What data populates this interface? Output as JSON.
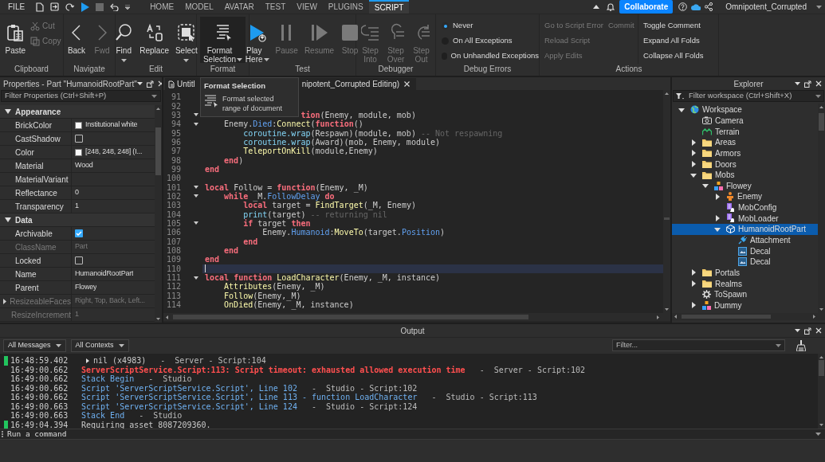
{
  "menu": {
    "file": "FILE",
    "tabs": [
      {
        "label": "HOME",
        "selected": false
      },
      {
        "label": "MODEL",
        "selected": false
      },
      {
        "label": "AVATAR",
        "selected": false
      },
      {
        "label": "TEST",
        "selected": false
      },
      {
        "label": "VIEW",
        "selected": false
      },
      {
        "label": "PLUGINS",
        "selected": false
      },
      {
        "label": "SCRIPT",
        "selected": true
      }
    ],
    "collaborate": "Collaborate",
    "user": "Omnipotent_Corrupted"
  },
  "ribbon": {
    "groups": [
      {
        "label": "Clipboard",
        "kind": "buttons",
        "items": [
          {
            "kind": "large",
            "label": "Paste",
            "disabled": false,
            "dropdown": false,
            "active": false
          },
          {
            "kind": "small",
            "label": "Cut",
            "disabled": true
          },
          {
            "kind": "small",
            "label": "Copy",
            "disabled": true
          }
        ]
      },
      {
        "label": "Navigate",
        "kind": "buttons",
        "items": [
          {
            "kind": "large",
            "label": "Back",
            "disabled": false,
            "dropdown": false,
            "active": false
          },
          {
            "kind": "large",
            "label": "Fwd",
            "disabled": true,
            "dropdown": false,
            "active": false
          }
        ]
      },
      {
        "label": "Edit",
        "kind": "buttons",
        "items": [
          {
            "kind": "large",
            "label": "Find",
            "disabled": false,
            "dropdown": true,
            "active": false
          },
          {
            "kind": "large",
            "label": "Replace",
            "disabled": false,
            "dropdown": false,
            "active": false
          },
          {
            "kind": "large",
            "label": "Select",
            "disabled": false,
            "dropdown": true,
            "active": false
          }
        ]
      },
      {
        "label": "Format",
        "kind": "buttons",
        "items": [
          {
            "kind": "large",
            "label": "Format Selection",
            "disabled": false,
            "dropdown": true,
            "active": true
          }
        ]
      },
      {
        "label": "Test",
        "kind": "buttons",
        "items": [
          {
            "kind": "large",
            "label": "Play Here",
            "disabled": false,
            "dropdown": true,
            "active": false
          },
          {
            "kind": "large",
            "label": "Pause",
            "disabled": true,
            "dropdown": false,
            "active": false
          },
          {
            "kind": "large",
            "label": "Resume",
            "disabled": true,
            "dropdown": false,
            "active": false
          },
          {
            "kind": "large",
            "label": "Stop",
            "disabled": true,
            "dropdown": false,
            "active": false
          }
        ]
      },
      {
        "label": "Debugger",
        "kind": "buttons",
        "items": [
          {
            "kind": "large",
            "label": "Step Into",
            "disabled": true,
            "dropdown": false,
            "active": false
          },
          {
            "kind": "large",
            "label": "Step Over",
            "disabled": true,
            "dropdown": false,
            "active": false
          },
          {
            "kind": "large",
            "label": "Step Out",
            "disabled": true,
            "dropdown": false,
            "active": false
          }
        ]
      },
      {
        "label": "Debug Errors",
        "kind": "radios",
        "items": [
          {
            "label": "Never",
            "selected": true
          },
          {
            "label": "On All Exceptions",
            "selected": false
          },
          {
            "label": "On Unhandled Exceptions",
            "selected": false
          }
        ]
      },
      {
        "label": "Actions",
        "kind": "columns",
        "columns": [
          [
            [
              {
                "label": "Go to Script Error",
                "disabled": true
              },
              {
                "label": "Commit",
                "disabled": true
              }
            ],
            [
              {
                "label": "Reload Script",
                "disabled": true
              }
            ],
            [
              {
                "label": "Apply Edits",
                "disabled": true
              }
            ]
          ],
          [
            [
              {
                "label": "Toggle Comment",
                "disabled": false
              }
            ],
            [
              {
                "label": "Expand All Folds",
                "disabled": false
              }
            ],
            [
              {
                "label": "Collapse All Folds",
                "disabled": false
              }
            ]
          ]
        ]
      }
    ]
  },
  "properties": {
    "title": "Properties - Part \"HumanoidRootPart\"",
    "filter_placeholder": "Filter Properties (Ctrl+Shift+P)",
    "sections": [
      {
        "name": "Appearance",
        "expanded": true,
        "rows": [
          {
            "name": "BrickColor",
            "kind": "swatch",
            "value": "Institutional white",
            "color": "#f8f8f8",
            "disabled": false
          },
          {
            "name": "CastShadow",
            "kind": "checkbox",
            "checked": false,
            "disabled": false
          },
          {
            "name": "Color",
            "kind": "swatch",
            "value": "[248, 248, 248] (I...",
            "color": "#f8f8f8",
            "disabled": false
          },
          {
            "name": "Material",
            "kind": "text",
            "value": "Wood",
            "disabled": false
          },
          {
            "name": "MaterialVariant",
            "kind": "text",
            "disabled": false
          },
          {
            "name": "Reflectance",
            "kind": "text",
            "value": "0",
            "disabled": false
          },
          {
            "name": "Transparency",
            "kind": "text",
            "value": "1",
            "disabled": false
          }
        ]
      },
      {
        "name": "Data",
        "expanded": true,
        "rows": [
          {
            "name": "Archivable",
            "kind": "checkbox",
            "checked": true,
            "disabled": false
          },
          {
            "name": "ClassName",
            "kind": "text",
            "value": "Part",
            "disabled": true
          },
          {
            "name": "Locked",
            "kind": "checkbox",
            "checked": false,
            "disabled": false
          },
          {
            "name": "Name",
            "kind": "text",
            "value": "HumanoidRootPart",
            "disabled": false
          },
          {
            "name": "Parent",
            "kind": "text",
            "value": "Flowey",
            "disabled": false
          },
          {
            "name": "ResizeableFaces",
            "kind": "group",
            "value": "Right, Top, Back, Left...",
            "disabled": true
          },
          {
            "name": "ResizeIncrement",
            "kind": "text",
            "value": "1",
            "disabled": true
          }
        ]
      }
    ]
  },
  "editor": {
    "tab_start": "Untitl",
    "tab_end": "nipotent_Corrupted Editing)",
    "tooltip": {
      "title": "Format Selection",
      "text": "Format selected range of document"
    },
    "lines": [
      {
        "n": "91",
        "fold": false,
        "current": false
      },
      {
        "n": "92",
        "fold": false,
        "current": false
      },
      {
        "n": "93",
        "fold": true,
        "current": false,
        "tokens": [
          {
            "kind": "k",
            "text": "                    tion"
          },
          {
            "kind": "p",
            "text": "(Enemy, module, mob)"
          }
        ]
      },
      {
        "n": "94",
        "fold": true,
        "current": false,
        "tokens": [
          {
            "kind": "p",
            "text": "    Enemy."
          },
          {
            "kind": "m",
            "text": "Died"
          },
          {
            "kind": "p",
            "text": ":"
          },
          {
            "kind": "f",
            "text": "Connect"
          },
          {
            "kind": "p",
            "text": "("
          },
          {
            "kind": "k",
            "text": "function"
          },
          {
            "kind": "p",
            "text": "()"
          }
        ]
      },
      {
        "n": "95",
        "fold": false,
        "current": false,
        "tokens": [
          {
            "kind": "b",
            "text": "        coroutine.wrap"
          },
          {
            "kind": "p",
            "text": "(Respawn)(module, mob)"
          },
          {
            "kind": "c",
            "text": " -- Not respawning"
          }
        ]
      },
      {
        "n": "96",
        "fold": false,
        "current": false,
        "tokens": [
          {
            "kind": "b",
            "text": "        coroutine.wrap"
          },
          {
            "kind": "p",
            "text": "(Award)(mob, Enemy, module)"
          }
        ]
      },
      {
        "n": "97",
        "fold": false,
        "current": false,
        "tokens": [
          {
            "kind": "f",
            "text": "        TeleportOnKill"
          },
          {
            "kind": "p",
            "text": "(module,Enemy)"
          }
        ]
      },
      {
        "n": "98",
        "fold": false,
        "current": false,
        "tokens": [
          {
            "kind": "k",
            "text": "    end"
          },
          {
            "kind": "p",
            "text": ")"
          }
        ]
      },
      {
        "n": "99",
        "fold": false,
        "current": false,
        "tokens": [
          {
            "kind": "k",
            "text": "end"
          }
        ]
      },
      {
        "n": "100",
        "fold": false,
        "current": false
      },
      {
        "n": "101",
        "fold": true,
        "current": false,
        "tokens": [
          {
            "kind": "k",
            "text": "local"
          },
          {
            "kind": "p",
            "text": " Follow = "
          },
          {
            "kind": "k",
            "text": "function"
          },
          {
            "kind": "p",
            "text": "(Enemy, _M)"
          }
        ]
      },
      {
        "n": "102",
        "fold": true,
        "current": false,
        "tokens": [
          {
            "kind": "k",
            "text": "    while"
          },
          {
            "kind": "p",
            "text": " _M."
          },
          {
            "kind": "m",
            "text": "FollowDelay"
          },
          {
            "kind": "k",
            "text": " do"
          }
        ]
      },
      {
        "n": "103",
        "fold": false,
        "current": false,
        "tokens": [
          {
            "kind": "k",
            "text": "        local"
          },
          {
            "kind": "p",
            "text": " target = "
          },
          {
            "kind": "f",
            "text": "FindTarget"
          },
          {
            "kind": "p",
            "text": "(_M, Enemy)"
          }
        ]
      },
      {
        "n": "104",
        "fold": false,
        "current": false,
        "tokens": [
          {
            "kind": "b",
            "text": "        print"
          },
          {
            "kind": "p",
            "text": "(target)"
          },
          {
            "kind": "c",
            "text": " -- returning nil"
          }
        ]
      },
      {
        "n": "105",
        "fold": true,
        "current": false,
        "tokens": [
          {
            "kind": "k",
            "text": "        if"
          },
          {
            "kind": "p",
            "text": " target "
          },
          {
            "kind": "k",
            "text": "then"
          }
        ]
      },
      {
        "n": "106",
        "fold": false,
        "current": false,
        "tokens": [
          {
            "kind": "p",
            "text": "            Enemy."
          },
          {
            "kind": "m",
            "text": "Humanoid"
          },
          {
            "kind": "p",
            "text": ":"
          },
          {
            "kind": "f",
            "text": "MoveTo"
          },
          {
            "kind": "p",
            "text": "(target."
          },
          {
            "kind": "m",
            "text": "Position"
          },
          {
            "kind": "p",
            "text": ")"
          }
        ]
      },
      {
        "n": "107",
        "fold": false,
        "current": false,
        "tokens": [
          {
            "kind": "k",
            "text": "        end"
          }
        ]
      },
      {
        "n": "108",
        "fold": false,
        "current": false,
        "tokens": [
          {
            "kind": "k",
            "text": "    end"
          }
        ]
      },
      {
        "n": "109",
        "fold": false,
        "current": false,
        "tokens": [
          {
            "kind": "k",
            "text": "end"
          }
        ]
      },
      {
        "n": "110",
        "fold": false,
        "current": true
      },
      {
        "n": "111",
        "fold": true,
        "current": false,
        "tokens": [
          {
            "kind": "k",
            "text": "local"
          },
          {
            "kind": "k",
            "text": " function"
          },
          {
            "kind": "f",
            "text": " LoadCharacter"
          },
          {
            "kind": "p",
            "text": "(Enemy, _M, instance)"
          }
        ]
      },
      {
        "n": "112",
        "fold": false,
        "current": false,
        "tokens": [
          {
            "kind": "f",
            "text": "    Attributes"
          },
          {
            "kind": "p",
            "text": "(Enemy, _M)"
          }
        ]
      },
      {
        "n": "113",
        "fold": false,
        "current": false,
        "tokens": [
          {
            "kind": "f",
            "text": "    Follow"
          },
          {
            "kind": "p",
            "text": "(Enemy,_M)"
          }
        ]
      },
      {
        "n": "114",
        "fold": false,
        "current": false,
        "tokens": [
          {
            "kind": "f",
            "text": "    OnDied"
          },
          {
            "kind": "p",
            "text": "(Enemy, _M, instance)"
          }
        ]
      }
    ]
  },
  "explorer": {
    "title": "Explorer",
    "filter_placeholder": "Filter workspace (Ctrl+Shift+X)",
    "tree": [
      {
        "name": "Workspace",
        "kind": "globe",
        "expandable": true,
        "expanded": true,
        "selected": false,
        "children": [
          {
            "name": "Camera",
            "kind": "camera",
            "expandable": false,
            "selected": false
          },
          {
            "name": "Terrain",
            "kind": "terrain",
            "expandable": false,
            "selected": false
          },
          {
            "name": "Areas",
            "kind": "folder",
            "expandable": true,
            "expanded": false,
            "selected": false
          },
          {
            "name": "Armors",
            "kind": "folder",
            "expandable": true,
            "expanded": false,
            "selected": false
          },
          {
            "name": "Doors",
            "kind": "folder",
            "expandable": true,
            "expanded": false,
            "selected": false
          },
          {
            "name": "Mobs",
            "kind": "folder",
            "expandable": true,
            "expanded": true,
            "selected": false,
            "children": [
              {
                "name": "Flowey",
                "kind": "model",
                "expandable": true,
                "expanded": true,
                "selected": false,
                "children": [
                  {
                    "name": "Enemy",
                    "kind": "humanoid",
                    "expandable": true,
                    "expanded": false,
                    "selected": false
                  },
                  {
                    "name": "MobConfig",
                    "kind": "script",
                    "expandable": false,
                    "selected": false
                  },
                  {
                    "name": "MobLoader",
                    "kind": "script",
                    "expandable": true,
                    "expanded": false,
                    "selected": false
                  },
                  {
                    "name": "HumanoidRootPart",
                    "kind": "part",
                    "expandable": true,
                    "expanded": true,
                    "selected": true,
                    "children": [
                      {
                        "name": "Attachment",
                        "kind": "attachment",
                        "expandable": false,
                        "selected": false
                      },
                      {
                        "name": "Decal",
                        "kind": "decal",
                        "expandable": false,
                        "selected": false
                      },
                      {
                        "name": "Decal",
                        "kind": "decal",
                        "expandable": false,
                        "selected": false
                      }
                    ]
                  }
                ]
              }
            ]
          },
          {
            "name": "Portals",
            "kind": "folder",
            "expandable": true,
            "expanded": false,
            "selected": false
          },
          {
            "name": "Realms",
            "kind": "folder",
            "expandable": true,
            "expanded": false,
            "selected": false
          },
          {
            "name": "ToSpawn",
            "kind": "gear",
            "expandable": false,
            "selected": false
          },
          {
            "name": "Dummy",
            "kind": "model",
            "expandable": true,
            "expanded": false,
            "selected": false
          }
        ]
      }
    ]
  },
  "output": {
    "title": "Output",
    "filters": [
      "All Messages",
      "All Contexts"
    ],
    "filter_placeholder": "Filter...",
    "lines": [
      {
        "time": "16:48:59.402",
        "message": "nil (x4983)",
        "source": "-  Server - Script:104",
        "kind": "info",
        "marked": true,
        "group": true
      },
      {
        "time": "16:49:00.662",
        "message": "ServerScriptService.Script:113: Script timeout: exhausted allowed execution time",
        "source": "-  Server - Script:102",
        "kind": "error",
        "marked": false,
        "group": false
      },
      {
        "time": "16:49:00.662",
        "message": "Stack Begin",
        "source": "-  Studio",
        "kind": "trace",
        "marked": false,
        "group": false
      },
      {
        "time": "16:49:00.662",
        "message": "Script 'ServerScriptService.Script', Line 102",
        "source": "-  Studio - Script:102",
        "kind": "trace",
        "marked": false,
        "group": false
      },
      {
        "time": "16:49:00.662",
        "message": "Script 'ServerScriptService.Script', Line 113 - function LoadCharacter",
        "source": "-  Studio - Script:113",
        "kind": "trace",
        "marked": false,
        "group": false
      },
      {
        "time": "16:49:00.663",
        "message": "Script 'ServerScriptService.Script', Line 124",
        "source": "-  Studio - Script:124",
        "kind": "trace",
        "marked": false,
        "group": false
      },
      {
        "time": "16:49:00.663",
        "message": "Stack End",
        "source": "-  Studio",
        "kind": "trace",
        "marked": false,
        "group": false
      },
      {
        "time": "16:49:04.394",
        "message": "Requiring asset 8087209360.",
        "kind": "info",
        "marked": true,
        "group": false
      }
    ],
    "command_placeholder": "Run a command"
  }
}
